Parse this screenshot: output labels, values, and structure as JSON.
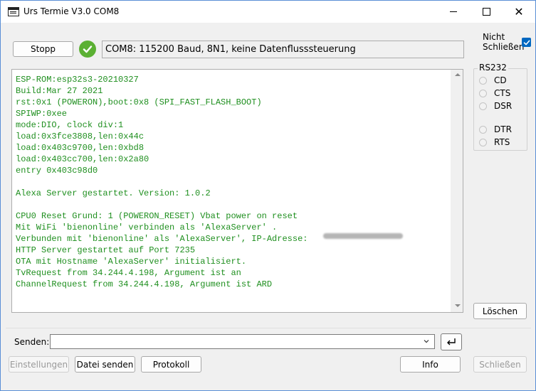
{
  "window": {
    "title": "Urs Termie V3.0 COM8"
  },
  "toolbar": {
    "stop_label": "Stopp",
    "status_text": "COM8: 115200 Baud, 8N1, keine Datenflusssteuerung",
    "nicht_schliessen_line1": "Nicht",
    "nicht_schliessen_line2": "Schließen",
    "nicht_schliessen_checked": true
  },
  "terminal": {
    "text_color": "#1f8f1f",
    "lines": [
      "ESP-ROM:esp32s3-20210327",
      "Build:Mar 27 2021",
      "rst:0x1 (POWERON),boot:0x8 (SPI_FAST_FLASH_BOOT)",
      "SPIWP:0xee",
      "mode:DIO, clock div:1",
      "load:0x3fce3808,len:0x44c",
      "load:0x403c9700,len:0xbd8",
      "load:0x403cc700,len:0x2a80",
      "entry 0x403c98d0",
      "",
      "Alexa Server gestartet. Version: 1.0.2",
      "",
      "CPU0 Reset Grund: 1 (POWERON_RESET) Vbat power on reset",
      "Mit WiFi 'bienonline' verbinden als 'AlexaServer' .",
      "Verbunden mit 'bienonline' als 'AlexaServer', IP-Adresse:",
      "HTTP Server gestartet auf Port 7235",
      "OTA mit Hostname 'AlexaServer' initialisiert.",
      "TvRequest from 34.244.4.198, Argument ist an",
      "ChannelRequest from 34.244.4.198, Argument ist ARD"
    ]
  },
  "rs232": {
    "title": "RS232",
    "signals": [
      {
        "label": "CD"
      },
      {
        "label": "CTS"
      },
      {
        "label": "DSR"
      },
      {
        "label": "DTR"
      },
      {
        "label": "RTS"
      }
    ]
  },
  "side": {
    "clear_label": "Löschen"
  },
  "send": {
    "label": "Senden:",
    "value": ""
  },
  "bottom": {
    "settings_label": "Einstellungen",
    "send_file_label": "Datei senden",
    "log_label": "Protokoll",
    "info_label": "Info",
    "close_label": "Schließen"
  },
  "colors": {
    "accent": "#0067c0",
    "ok_green": "#5bb033"
  }
}
